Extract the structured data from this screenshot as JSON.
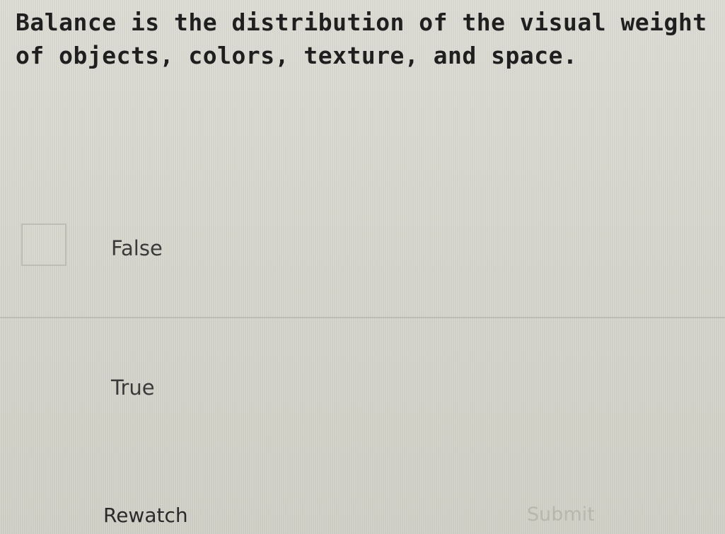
{
  "question": {
    "text": "Balance is the distribution of the visual weight of objects, colors, texture, and space."
  },
  "options": [
    {
      "label": "False",
      "selected": false
    },
    {
      "label": "True",
      "selected": false
    }
  ],
  "footer": {
    "rewatch_label": "Rewatch",
    "submit_label": "Submit",
    "submit_enabled": false
  },
  "colors": {
    "background": "#d6d6cd",
    "text": "#1f1f1f",
    "submit_disabled": "#b7b7ad"
  }
}
